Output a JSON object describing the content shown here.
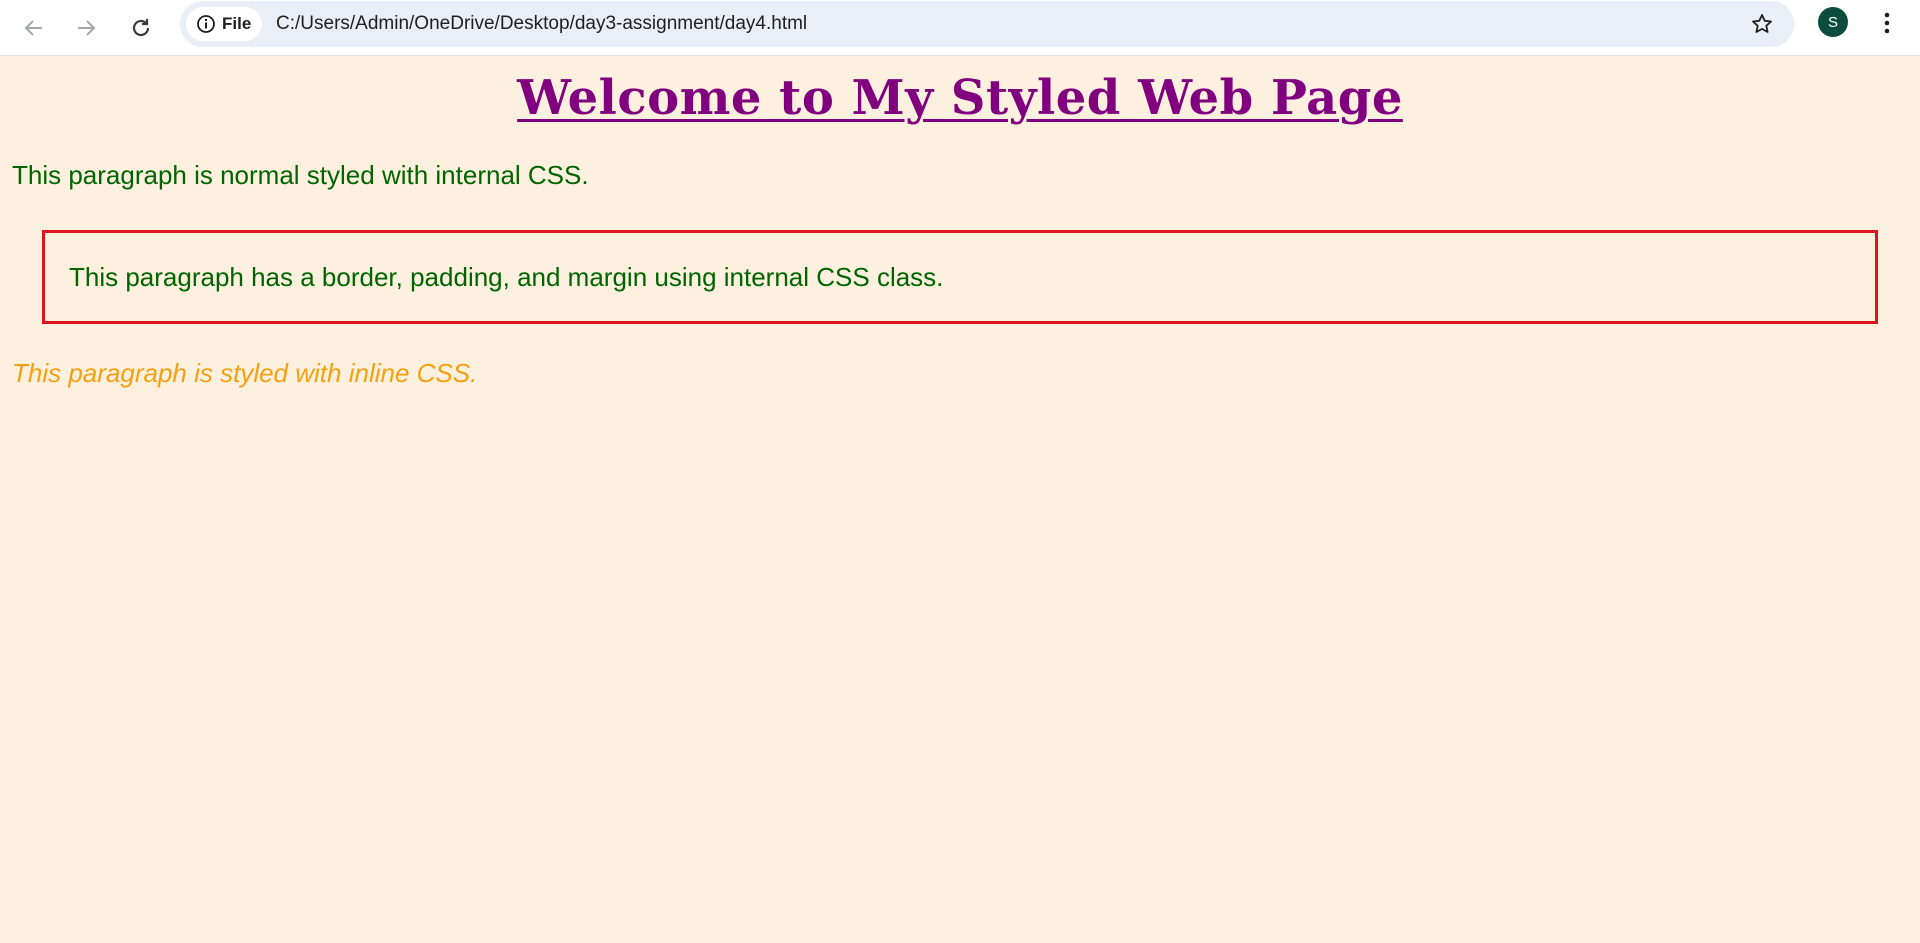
{
  "browser": {
    "site_chip_label": "File",
    "url": "C:/Users/Admin/OneDrive/Desktop/day3-assignment/day4.html",
    "profile_initial": "S",
    "icons": {
      "back": "back-arrow-icon",
      "forward": "forward-arrow-icon",
      "reload": "reload-icon",
      "info": "info-icon",
      "star": "star-icon",
      "menu": "kebab-menu-icon"
    }
  },
  "page": {
    "heading": "Welcome to My Styled Web Page",
    "para_normal": "This paragraph is normal styled with internal CSS.",
    "para_box": "This paragraph has a border, padding, and margin using internal CSS class.",
    "para_inline": "This paragraph is styled with inline CSS.",
    "colors": {
      "background": "#fdf0de",
      "heading": "#800080",
      "text_green": "#006400",
      "border_red": "#e0141e",
      "inline_orange": "#f5a010"
    }
  }
}
